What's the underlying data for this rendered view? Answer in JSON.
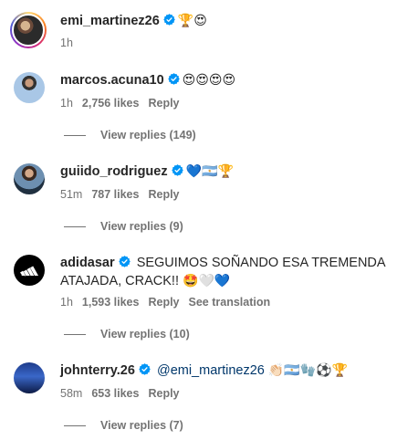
{
  "comments": [
    {
      "username": "emi_martinez26",
      "text": "",
      "emoji": "🏆😍",
      "time": "1h",
      "likes": "",
      "reply_label": "",
      "extra_action": "",
      "replies_label": ""
    },
    {
      "username": "marcos.acuna10",
      "text": "",
      "emoji": "😍😍😍😍",
      "time": "1h",
      "likes": "2,756 likes",
      "reply_label": "Reply",
      "extra_action": "",
      "replies_label": "View replies (149)"
    },
    {
      "username": "guiido_rodriguez",
      "text": "",
      "emoji": "💙🇦🇷🏆",
      "time": "51m",
      "likes": "787 likes",
      "reply_label": "Reply",
      "extra_action": "",
      "replies_label": "View replies (9)"
    },
    {
      "username": "adidasar",
      "text": "SEGUIMOS SOÑANDO ESA TREMENDA ATAJADA, CRACK!!",
      "emoji": "🤩🤍💙",
      "time": "1h",
      "likes": "1,593 likes",
      "reply_label": "Reply",
      "extra_action": "See translation",
      "replies_label": "View replies (10)"
    },
    {
      "username": "johnterry.26",
      "mention": "@emi_martinez26",
      "emoji": "👏🏻🇦🇷🧤⚽🏆",
      "time": "58m",
      "likes": "653 likes",
      "reply_label": "Reply",
      "extra_action": "",
      "replies_label": "View replies (7)"
    }
  ],
  "colors": {
    "text": "#262626",
    "secondary": "#737373",
    "verified": "#0095f6",
    "mention": "#00376b"
  }
}
